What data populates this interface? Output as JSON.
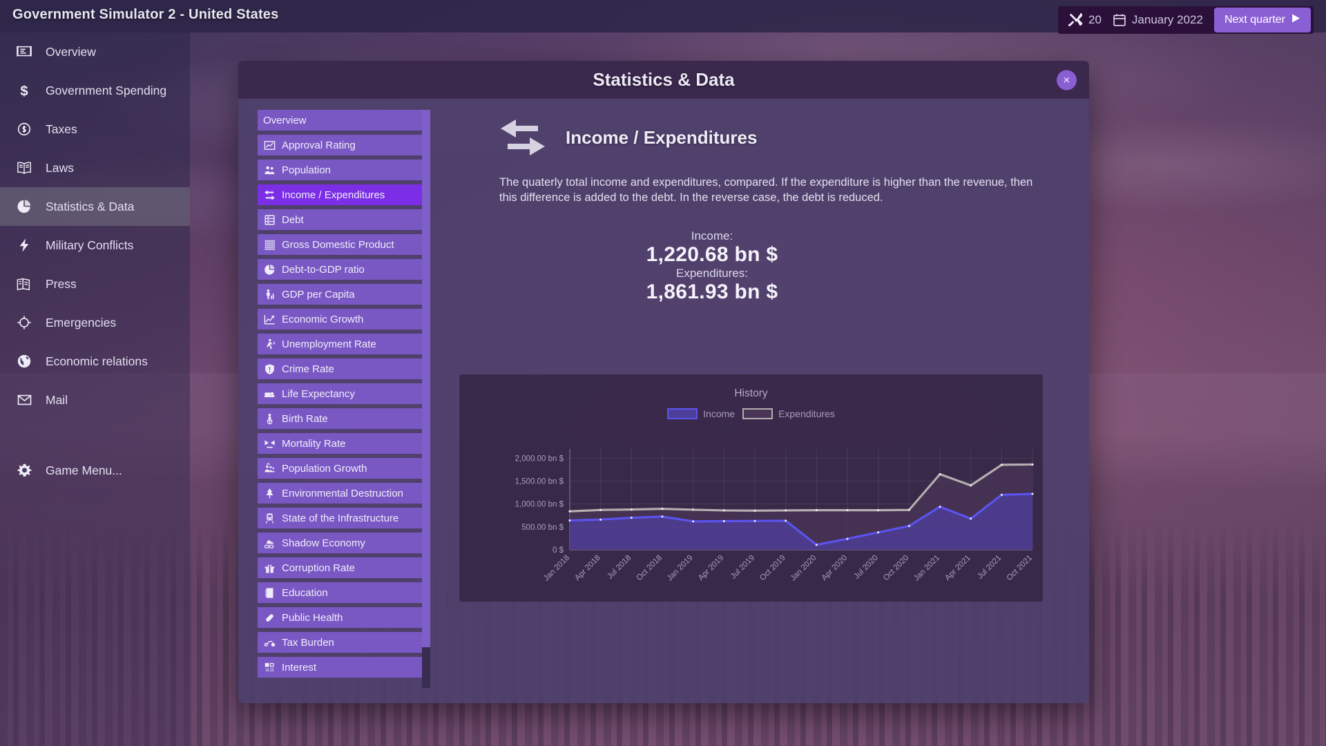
{
  "window": {
    "title": "Government Simulator 2 - United States"
  },
  "topbar": {
    "resource_value": "20",
    "date": "January 2022",
    "next_quarter_label": "Next quarter",
    "accent": "#8b5fd4"
  },
  "sidebar": {
    "items": [
      {
        "label": "Overview",
        "icon": "presentation-icon",
        "active": false
      },
      {
        "label": "Government Spending",
        "icon": "dollar-icon",
        "active": false
      },
      {
        "label": "Taxes",
        "icon": "coin-icon",
        "active": false
      },
      {
        "label": "Laws",
        "icon": "book-icon",
        "active": false
      },
      {
        "label": "Statistics & Data",
        "icon": "pie-chart-icon",
        "active": true
      },
      {
        "label": "Military Conflicts",
        "icon": "bolt-icon",
        "active": false
      },
      {
        "label": "Press",
        "icon": "newspaper-icon",
        "active": false
      },
      {
        "label": "Emergencies",
        "icon": "target-icon",
        "active": false
      },
      {
        "label": "Economic relations",
        "icon": "globe-icon",
        "active": false
      },
      {
        "label": "Mail",
        "icon": "envelope-icon",
        "active": false
      }
    ],
    "menu_item": {
      "label": "Game Menu...",
      "icon": "gear-icon"
    }
  },
  "modal": {
    "title": "Statistics & Data",
    "close_label": "✕",
    "stat_list": [
      {
        "label": "Overview",
        "icon": "none",
        "selected": false
      },
      {
        "label": "Approval Rating",
        "icon": "chart-up-icon",
        "selected": false
      },
      {
        "label": "Population",
        "icon": "people-icon",
        "selected": false
      },
      {
        "label": "Income / Expenditures",
        "icon": "exchange-icon",
        "selected": true
      },
      {
        "label": "Debt",
        "icon": "bank-icon",
        "selected": false
      },
      {
        "label": "Gross Domestic Product",
        "icon": "grid-icon",
        "selected": false
      },
      {
        "label": "Debt-to-GDP ratio",
        "icon": "pie-chart-icon",
        "selected": false
      },
      {
        "label": "GDP per Capita",
        "icon": "person-chart-icon",
        "selected": false
      },
      {
        "label": "Economic Growth",
        "icon": "line-chart-icon",
        "selected": false
      },
      {
        "label": "Unemployment Rate",
        "icon": "walking-person-icon",
        "selected": false
      },
      {
        "label": "Crime Rate",
        "icon": "shield-alert-icon",
        "selected": false
      },
      {
        "label": "Life Expectancy",
        "icon": "hospital-bed-icon",
        "selected": false
      },
      {
        "label": "Birth Rate",
        "icon": "baby-icon",
        "selected": false
      },
      {
        "label": "Mortality Rate",
        "icon": "hourglass-icon",
        "selected": false
      },
      {
        "label": "Population Growth",
        "icon": "people-growth-icon",
        "selected": false
      },
      {
        "label": "Environmental Destruction",
        "icon": "tree-icon",
        "selected": false
      },
      {
        "label": "State of the Infrastructure",
        "icon": "train-icon",
        "selected": false
      },
      {
        "label": "Shadow Economy",
        "icon": "cloud-money-icon",
        "selected": false
      },
      {
        "label": "Corruption Rate",
        "icon": "gift-icon",
        "selected": false
      },
      {
        "label": "Education",
        "icon": "book-closed-icon",
        "selected": false
      },
      {
        "label": "Public Health",
        "icon": "pill-icon",
        "selected": false
      },
      {
        "label": "Tax Burden",
        "icon": "link-icon",
        "selected": false
      },
      {
        "label": "Interest",
        "icon": "percent-icon",
        "selected": false
      }
    ],
    "detail": {
      "icon": "exchange-arrows-icon",
      "title": "Income / Expenditures",
      "description": "The quaterly total income and expenditures, compared. If the expenditure is higher than the revenue, then this difference is added to the debt. In the reverse case, the debt is reduced.",
      "income_label": "Income:",
      "income_value": "1,220.68 bn $",
      "expenditures_label": "Expenditures:",
      "expenditures_value": "1,861.93 bn $"
    }
  },
  "chart_data": {
    "type": "area",
    "title": "History",
    "xlabel": "",
    "ylabel": "",
    "ylim": [
      0,
      2200
    ],
    "y_ticks": [
      0,
      500,
      1000,
      1500,
      2000
    ],
    "y_tick_labels": [
      "0 $",
      "500.00 bn $",
      "1,000.00 bn $",
      "1,500.00 bn $",
      "2,000.00 bn $"
    ],
    "grid": true,
    "legend_position": "top-center",
    "categories": [
      "Jan 2018",
      "Apr 2018",
      "Jul 2018",
      "Oct 2018",
      "Jan 2019",
      "Apr 2019",
      "Jul 2019",
      "Oct 2019",
      "Jan 2020",
      "Apr 2020",
      "Jul 2020",
      "Oct 2020",
      "Jan 2021",
      "Apr 2021",
      "Jul 2021",
      "Oct 2021"
    ],
    "series": [
      {
        "name": "Income",
        "color": "#5b53ee",
        "fill": "#4d3f99",
        "values": [
          640,
          660,
          700,
          725,
          620,
          625,
          630,
          635,
          110,
          240,
          380,
          520,
          940,
          680,
          1200,
          1220.68
        ]
      },
      {
        "name": "Expenditures",
        "color": "#b3aeb0",
        "fill": "#4a3556",
        "values": [
          840,
          870,
          880,
          895,
          875,
          860,
          855,
          860,
          865,
          865,
          865,
          870,
          1650,
          1405,
          1855,
          1861.93
        ]
      }
    ]
  }
}
